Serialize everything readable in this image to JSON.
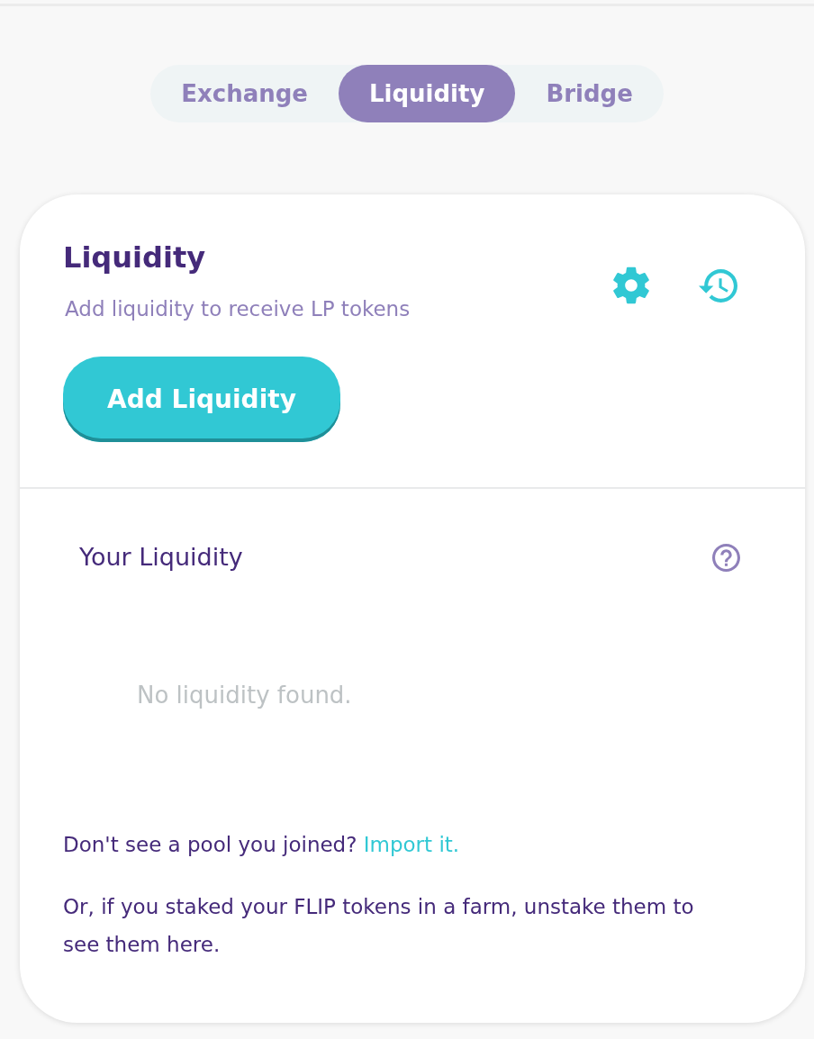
{
  "tabs": [
    {
      "label": "Exchange",
      "selected": false
    },
    {
      "label": "Liquidity",
      "selected": true
    },
    {
      "label": "Bridge",
      "selected": false
    }
  ],
  "card": {
    "title": "Liquidity",
    "subtitle": "Add liquidity to receive LP tokens",
    "add_button": "Add Liquidity"
  },
  "your_liquidity": {
    "heading": "Your Liquidity",
    "empty_message": "No liquidity found.",
    "import_prompt": {
      "text": "Don't see a pool you joined?",
      "link": "Import it."
    },
    "farm_note": "Or, if you staked your FLIP tokens in a farm, unstake them to see them here."
  }
}
